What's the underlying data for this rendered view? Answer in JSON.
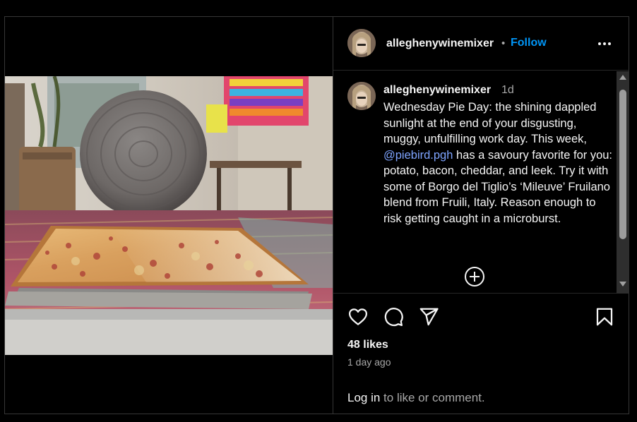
{
  "post": {
    "username": "alleghenywinemixer",
    "separator": "•",
    "follow_label": "Follow",
    "more_icon": "more-options-icon"
  },
  "caption": {
    "username": "alleghenywinemixer",
    "time": "1d",
    "text_before": "Wednesday Pie Day: the shining dappled sunlight at the end of your disgusting, muggy, unfulfilling work day. This week, ",
    "mention": "@piebird.pgh",
    "text_after": " has a savoury favorite for you: potato, bacon, cheddar, and leek. Try it with some of Borgo del Tiglio’s ‘Mileuve’ Fruilano blend from Fruili, Italy. Reason enough to risk getting caught in a microburst."
  },
  "actions": {
    "icons": [
      "heart-icon",
      "comment-icon",
      "share-icon",
      "bookmark-icon"
    ]
  },
  "stats": {
    "likes": "48 likes",
    "posted": "1 day ago"
  },
  "login": {
    "link": "Log in",
    "rest": " to like or comment."
  },
  "colors": {
    "background": "#000000",
    "accent": "#0095f6",
    "mention": "#7ea4ff",
    "secondary_text": "#a8a8a8"
  }
}
